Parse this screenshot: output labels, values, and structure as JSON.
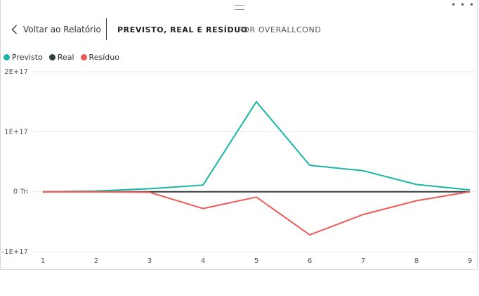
{
  "nav": {
    "back_label": "Voltar ao Relatório",
    "tabs": [
      {
        "label": "PREVISTO, REAL E RESÍDUO",
        "active": true
      },
      {
        "label": "POR OVERALLCOND",
        "active": false
      }
    ]
  },
  "icons": {
    "more": "ellipsis-icon",
    "grip": "drag-handle-icon",
    "back": "chevron-left-icon"
  },
  "colors": {
    "previsto": "#1ab5a5",
    "real": "#333d40",
    "residuo": "#ef5a5a"
  },
  "legend": [
    {
      "label": "Previsto",
      "color": "#1ab5a5"
    },
    {
      "label": "Real",
      "color": "#333d40"
    },
    {
      "label": "Resíduo",
      "color": "#ef5a5a"
    }
  ],
  "chart_data": {
    "type": "line",
    "x": [
      1,
      2,
      3,
      4,
      5,
      6,
      7,
      8,
      9
    ],
    "x_tick_labels": [
      "1",
      "2",
      "3",
      "4",
      "5",
      "6",
      "7",
      "8",
      "9"
    ],
    "y_ticks": [
      -1e+17,
      0,
      1e+17,
      2e+17
    ],
    "y_tick_labels": [
      "-1E+17",
      "0 Tri",
      "1E+17",
      "2E+17"
    ],
    "ylim": [
      -1e+17,
      2e+17
    ],
    "grid": true,
    "legend_position": "top-left",
    "series": [
      {
        "name": "Previsto",
        "color": "#1ab5a5",
        "values": [
          0,
          1000000000000000.0,
          5000000000000000.0,
          1.1e+16,
          1.5e+17,
          4.4e+16,
          3.5e+16,
          1.2e+16,
          3000000000000000.0
        ]
      },
      {
        "name": "Real",
        "color": "#333d40",
        "values": [
          0,
          0,
          0,
          0,
          0,
          0,
          0,
          0,
          0
        ]
      },
      {
        "name": "Resíduo",
        "color": "#ef5a5a",
        "values": [
          0,
          0,
          -1000000000000000.0,
          -2.8e+16,
          -9000000000000000.0,
          -7.2e+16,
          -3.8e+16,
          -1.5e+16,
          0
        ]
      }
    ]
  }
}
